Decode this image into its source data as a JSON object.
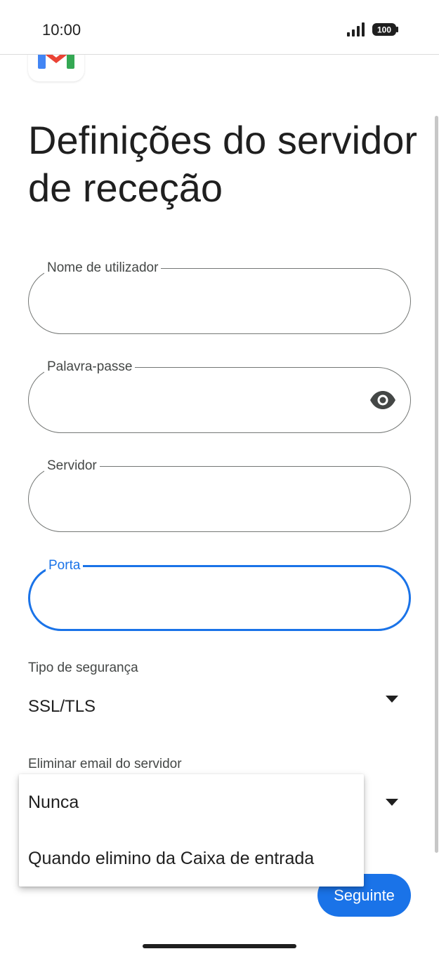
{
  "status_bar": {
    "time": "10:00",
    "battery": "100",
    "icons": [
      "signal-icon",
      "battery-icon"
    ]
  },
  "app": {
    "logo": "gmail-logo"
  },
  "page": {
    "title": "Definições do servidor de receção"
  },
  "fields": {
    "username": {
      "label": "Nome de utilizador",
      "value": ""
    },
    "password": {
      "label": "Palavra-passe",
      "value": "",
      "icon": "eye-icon"
    },
    "server": {
      "label": "Servidor",
      "value": ""
    },
    "port": {
      "label": "Porta",
      "value": "",
      "focused": true
    }
  },
  "security_type": {
    "label": "Tipo de segurança",
    "selected": "SSL/TLS"
  },
  "delete_from_server": {
    "label": "Eliminar email do servidor",
    "options": [
      "Nunca",
      "Quando elimino da Caixa de entrada"
    ]
  },
  "actions": {
    "next_label": "Seguinte"
  },
  "colors": {
    "accent": "#1a73e8",
    "outline": "#747775",
    "text": "#1f1f1f"
  }
}
